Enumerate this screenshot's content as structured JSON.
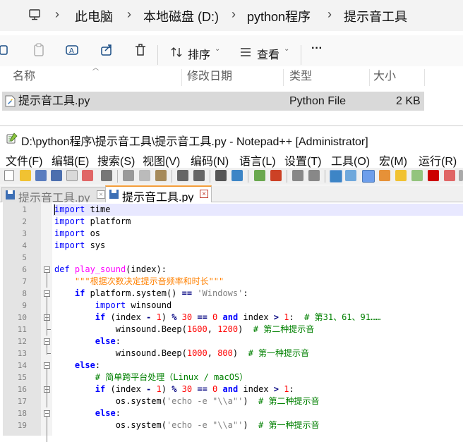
{
  "explorer": {
    "breadcrumb": [
      "此电脑",
      "本地磁盘 (D:)",
      "python程序",
      "提示音工具"
    ],
    "toolbar": {
      "sort_label": "排序",
      "view_label": "查看",
      "more_label": "···"
    },
    "columns": {
      "name": "名称",
      "modified": "修改日期",
      "type": "类型",
      "size": "大小"
    },
    "files": [
      {
        "name": "提示音工具.py",
        "modified": "",
        "type": "Python File",
        "size": "2 KB"
      }
    ]
  },
  "notepad": {
    "title": "D:\\python程序\\提示音工具\\提示音工具.py - Notepad++ [Administrator]",
    "menu": [
      "文件(F)",
      "编辑(E)",
      "搜索(S)",
      "视图(V)",
      "编码(N)",
      "语言(L)",
      "设置(T)",
      "工具(O)",
      "宏(M)",
      "运行(R)"
    ],
    "tabs": [
      {
        "label": "提示音工具.py",
        "active": false
      },
      {
        "label": "提示音工具.py",
        "active": true
      }
    ],
    "line_numbers": [
      "1",
      "2",
      "3",
      "4",
      "5",
      "6",
      "7",
      "8",
      "9",
      "10",
      "11",
      "12",
      "13",
      "14",
      "15",
      "16",
      "17",
      "18",
      "19"
    ],
    "colors": {
      "keyword": "#0000ff",
      "function": "#ff00ff",
      "string": "#808080",
      "docstring": "#ff8000",
      "number": "#ff0000",
      "comment": "#008000"
    },
    "code": {
      "l1": [
        "import",
        " time"
      ],
      "l2": [
        "import",
        " platform"
      ],
      "l3": [
        "import",
        " os"
      ],
      "l4": [
        "import",
        " sys"
      ],
      "l6": [
        "def",
        " ",
        "play_sound",
        "(index):"
      ],
      "l7": [
        "    ",
        "\"\"\"根据次数决定提示音频率和时长\"\"\""
      ],
      "l8": [
        "    ",
        "if",
        " platform.system() ",
        "==",
        " ",
        "'Windows'",
        ":"
      ],
      "l9": [
        "        ",
        "import",
        " winsound"
      ],
      "l10": [
        "        ",
        "if",
        " (index ",
        "-",
        " ",
        "1",
        ") ",
        "%",
        " ",
        "30",
        " ",
        "==",
        " ",
        "0",
        " ",
        "and",
        " index ",
        ">",
        " ",
        "1",
        ":  ",
        "# 第31、61、91……"
      ],
      "l11": [
        "            winsound.Beep(",
        "1600",
        ", ",
        "1200",
        ")  ",
        "# 第二种提示音"
      ],
      "l12": [
        "        ",
        "else",
        ":"
      ],
      "l13": [
        "            winsound.Beep(",
        "1000",
        ", ",
        "800",
        ")  ",
        "# 第一种提示音"
      ],
      "l14": [
        "    ",
        "else",
        ":"
      ],
      "l15": [
        "        ",
        "# 简单跨平台处理（Linux / macOS）"
      ],
      "l16": [
        "        ",
        "if",
        " (index ",
        "-",
        " ",
        "1",
        ") ",
        "%",
        " ",
        "30",
        " ",
        "==",
        " ",
        "0",
        " ",
        "and",
        " index ",
        ">",
        " ",
        "1",
        ":"
      ],
      "l17": [
        "            os.system(",
        "'echo -e \"\\\\a\"'",
        ")  ",
        "# 第二种提示音"
      ],
      "l18": [
        "        ",
        "else",
        ":"
      ],
      "l19": [
        "            os.system(",
        "'echo -e \"\\\\a\"'",
        ")  ",
        "# 第一种提示音"
      ]
    }
  }
}
